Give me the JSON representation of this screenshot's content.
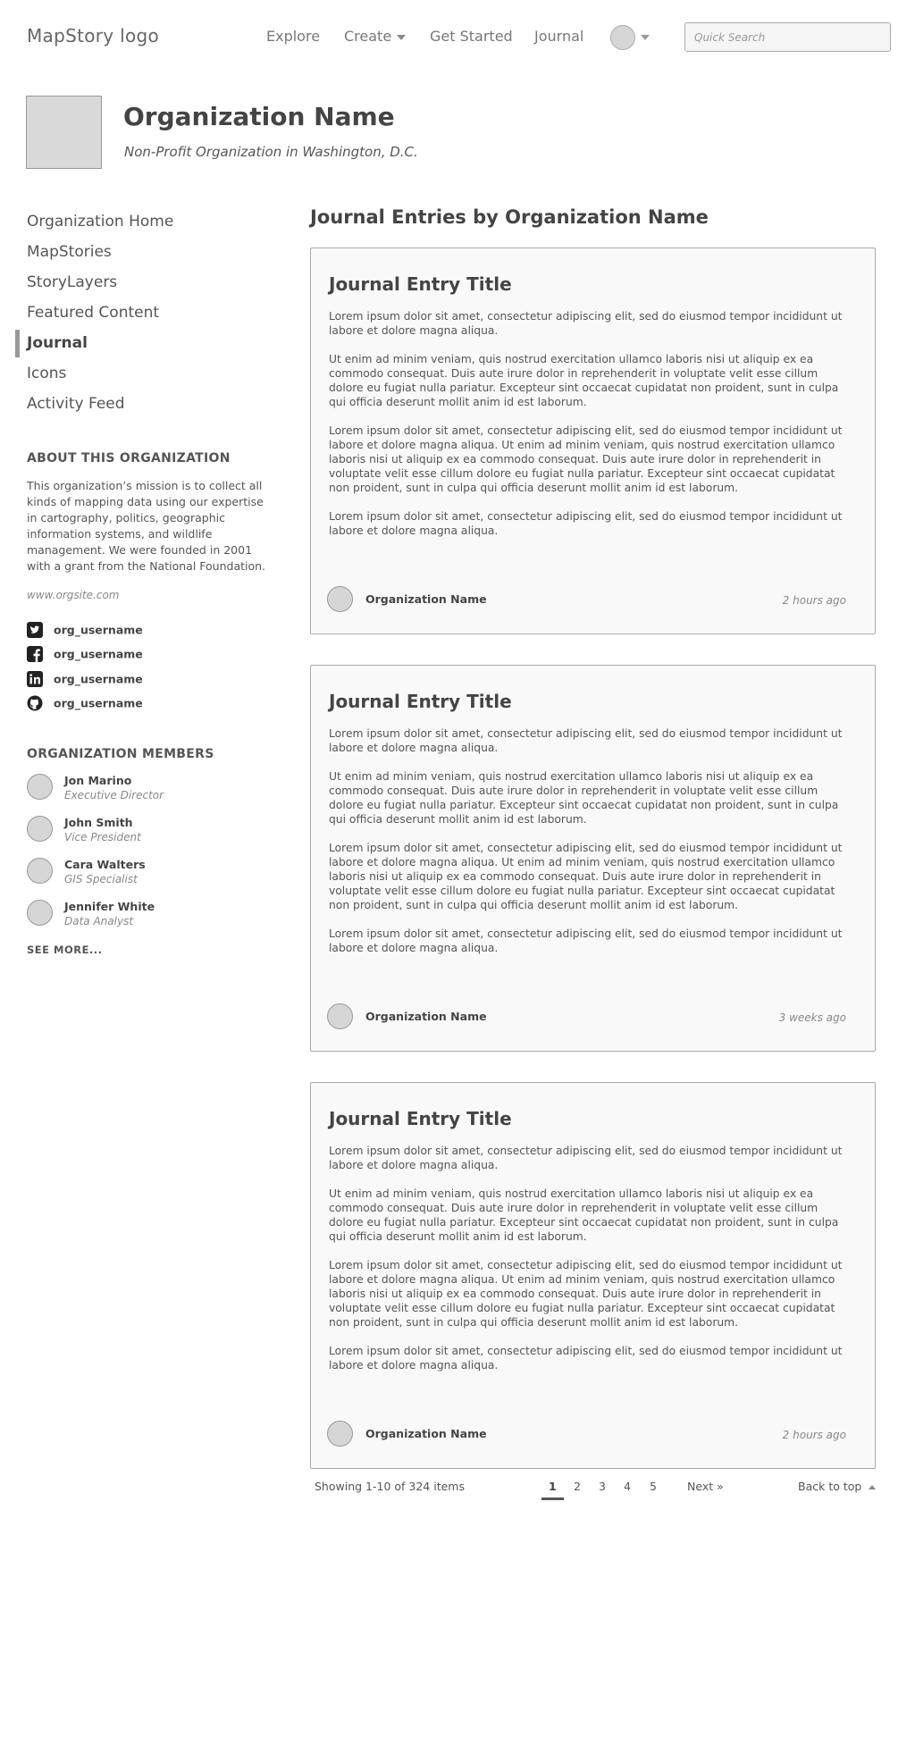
{
  "header": {
    "logo": "MapStory logo",
    "nav": {
      "explore": "Explore",
      "create": "Create",
      "get_started": "Get Started",
      "journal": "Journal"
    },
    "search_placeholder": "Quick Search"
  },
  "org": {
    "name": "Organization Name",
    "subtitle": "Non-Profit Organization in Washington, D.C."
  },
  "sidebar": {
    "items": [
      {
        "label": "Organization Home"
      },
      {
        "label": "MapStories"
      },
      {
        "label": "StoryLayers"
      },
      {
        "label": "Featured Content"
      },
      {
        "label": "Journal",
        "active": true
      },
      {
        "label": "Icons"
      },
      {
        "label": "Activity Feed"
      }
    ],
    "about_heading": "ABOUT THIS ORGANIZATION",
    "about_text": "This organization’s mission is to collect all kinds of mapping data using our expertise in cartography, politics, geographic information systems, and wildlife management. We were founded in 2001 with a grant from the National Foundation.",
    "website": "www.orgsite.com",
    "social": [
      {
        "icon": "twitter-icon",
        "username": "org_username"
      },
      {
        "icon": "facebook-icon",
        "username": "org_username"
      },
      {
        "icon": "linkedin-icon",
        "username": "org_username"
      },
      {
        "icon": "github-icon",
        "username": "org_username"
      }
    ],
    "members_heading": "ORGANIZATION MEMBERS",
    "members": [
      {
        "name": "Jon Marino",
        "role": "Executive Director"
      },
      {
        "name": "John Smith",
        "role": "Vice President"
      },
      {
        "name": "Cara Walters",
        "role": "GIS Specialist"
      },
      {
        "name": "Jennifer White",
        "role": "Data Analyst"
      }
    ],
    "see_more": "SEE MORE..."
  },
  "main": {
    "title": "Journal Entries by Organization Name",
    "entries": [
      {
        "title": "Journal Entry Title",
        "paragraphs": [
          "Lorem ipsum dolor sit amet, consectetur adipiscing elit, sed do eiusmod tempor incididunt ut labore et dolore magna aliqua.",
          "Ut enim ad minim veniam, quis nostrud exercitation ullamco laboris nisi ut aliquip ex ea commodo consequat. Duis aute irure dolor in reprehenderit in voluptate velit esse cillum dolore eu fugiat nulla pariatur. Excepteur sint occaecat cupidatat non proident, sunt in culpa qui officia deserunt mollit anim id est laborum.",
          "Lorem ipsum dolor sit amet, consectetur adipiscing elit, sed do eiusmod tempor incididunt ut labore et dolore magna aliqua. Ut enim ad minim veniam, quis nostrud exercitation ullamco laboris nisi ut aliquip ex ea commodo consequat. Duis aute irure dolor in reprehenderit in voluptate velit esse cillum dolore eu fugiat nulla pariatur. Excepteur sint occaecat cupidatat non proident, sunt in culpa qui officia deserunt mollit anim id est laborum.",
          "Lorem ipsum dolor sit amet, consectetur adipiscing elit, sed do eiusmod tempor incididunt ut labore et dolore magna aliqua."
        ],
        "author": "Organization Name",
        "time": "2 hours ago"
      },
      {
        "title": "Journal Entry Title",
        "paragraphs": [
          "Lorem ipsum dolor sit amet, consectetur adipiscing elit, sed do eiusmod tempor incididunt ut labore et dolore magna aliqua.",
          "Ut enim ad minim veniam, quis nostrud exercitation ullamco laboris nisi ut aliquip ex ea commodo consequat. Duis aute irure dolor in reprehenderit in voluptate velit esse cillum dolore eu fugiat nulla pariatur. Excepteur sint occaecat cupidatat non proident, sunt in culpa qui officia deserunt mollit anim id est laborum.",
          "Lorem ipsum dolor sit amet, consectetur adipiscing elit, sed do eiusmod tempor incididunt ut labore et dolore magna aliqua. Ut enim ad minim veniam, quis nostrud exercitation ullamco laboris nisi ut aliquip ex ea commodo consequat. Duis aute irure dolor in reprehenderit in voluptate velit esse cillum dolore eu fugiat nulla pariatur. Excepteur sint occaecat cupidatat non proident, sunt in culpa qui officia deserunt mollit anim id est laborum.",
          "Lorem ipsum dolor sit amet, consectetur adipiscing elit, sed do eiusmod tempor incididunt ut labore et dolore magna aliqua."
        ],
        "author": "Organization Name",
        "time": "3 weeks ago"
      },
      {
        "title": "Journal Entry Title",
        "paragraphs": [
          "Lorem ipsum dolor sit amet, consectetur adipiscing elit, sed do eiusmod tempor incididunt ut labore et dolore magna aliqua.",
          "Ut enim ad minim veniam, quis nostrud exercitation ullamco laboris nisi ut aliquip ex ea commodo consequat. Duis aute irure dolor in reprehenderit in voluptate velit esse cillum dolore eu fugiat nulla pariatur. Excepteur sint occaecat cupidatat non proident, sunt in culpa qui officia deserunt mollit anim id est laborum.",
          "Lorem ipsum dolor sit amet, consectetur adipiscing elit, sed do eiusmod tempor incididunt ut labore et dolore magna aliqua. Ut enim ad minim veniam, quis nostrud exercitation ullamco laboris nisi ut aliquip ex ea commodo consequat. Duis aute irure dolor in reprehenderit in voluptate velit esse cillum dolore eu fugiat nulla pariatur. Excepteur sint occaecat cupidatat non proident, sunt in culpa qui officia deserunt mollit anim id est laborum.",
          "Lorem ipsum dolor sit amet, consectetur adipiscing elit, sed do eiusmod tempor incididunt ut labore et dolore magna aliqua."
        ],
        "author": "Organization Name",
        "time": "2 hours ago"
      }
    ]
  },
  "pagination": {
    "showing": "Showing 1-10 of 324 items",
    "pages": [
      "1",
      "2",
      "3",
      "4",
      "5"
    ],
    "current": "1",
    "next": "Next »",
    "back_to_top": "Back to top"
  }
}
